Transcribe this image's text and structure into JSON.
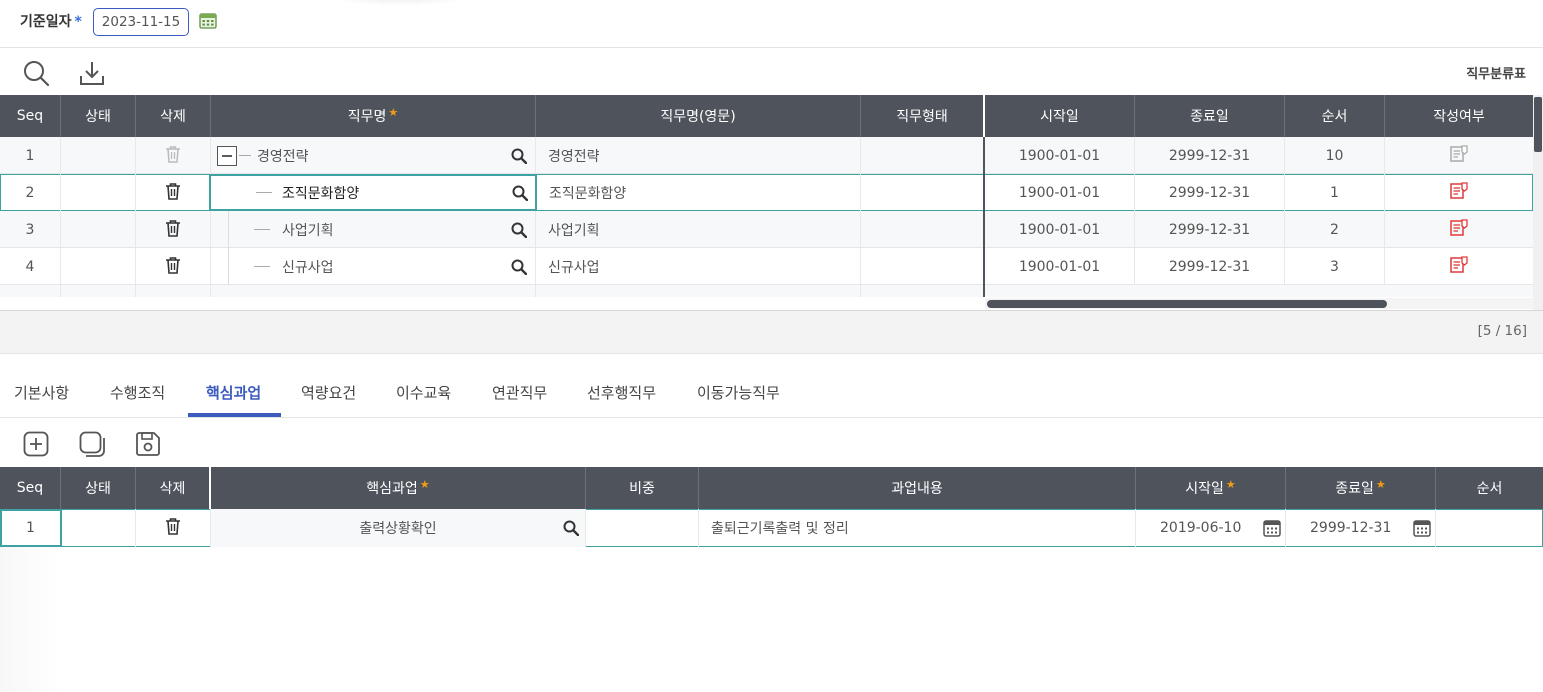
{
  "filter": {
    "label": "기준일자",
    "required_mark": "*",
    "date_value": "2023-11-15",
    "calendar_icon": "calendar-icon"
  },
  "toolbar1": {
    "search_icon": "search-icon",
    "download_icon": "download-icon",
    "right_label": "직무분류표"
  },
  "grid1": {
    "columns": {
      "seq": "Seq",
      "status": "상태",
      "delete": "삭제",
      "job_name": "직무명",
      "job_name_en": "직무명(영문)",
      "job_type": "직무형태",
      "start_date": "시작일",
      "end_date": "종료일",
      "order": "순서",
      "written": "작성여부"
    },
    "required_star": "★",
    "rows": [
      {
        "seq": "1",
        "name": "경영전략",
        "name_en": "경영전략",
        "start": "1900-01-01",
        "end": "2999-12-31",
        "order": "10",
        "written": "not-written",
        "tree": "collapse"
      },
      {
        "seq": "2",
        "name": "조직문화함양",
        "name_en": "조직문화함양",
        "start": "1900-01-01",
        "end": "2999-12-31",
        "order": "1",
        "written": "written",
        "selected": true
      },
      {
        "seq": "3",
        "name": "사업기획",
        "name_en": "사업기획",
        "start": "1900-01-01",
        "end": "2999-12-31",
        "order": "2",
        "written": "written"
      },
      {
        "seq": "4",
        "name": "신규사업",
        "name_en": "신규사업",
        "start": "1900-01-01",
        "end": "2999-12-31",
        "order": "3",
        "written": "written"
      }
    ],
    "page_count": "[5 / 16]"
  },
  "tabs": [
    {
      "label": "기본사항"
    },
    {
      "label": "수행조직"
    },
    {
      "label": "핵심과업",
      "active": true
    },
    {
      "label": "역량요건"
    },
    {
      "label": "이수교육"
    },
    {
      "label": "연관직무"
    },
    {
      "label": "선후행직무"
    },
    {
      "label": "이동가능직무"
    }
  ],
  "toolbar2": {
    "add_icon": "add-icon",
    "copy_icon": "copy-icon",
    "save_icon": "save-icon"
  },
  "grid2": {
    "columns": {
      "seq": "Seq",
      "status": "상태",
      "delete": "삭제",
      "core_task": "핵심과업",
      "weight": "비중",
      "task_content": "과업내용",
      "start_date": "시작일",
      "end_date": "종료일",
      "order": "순서"
    },
    "rows": [
      {
        "seq": "1",
        "status": "",
        "core_task": "출력상황확인",
        "weight": "",
        "task_content": "출퇴근기록출력 및 정리",
        "start": "2019-06-10",
        "end": "2999-12-31",
        "order": ""
      }
    ]
  },
  "colors": {
    "header_bg": "#4e535c",
    "accent": "#3b5bbf",
    "selection": "#3fa2a2",
    "required_star": "#f39c12",
    "written_icon": "#e03a3a"
  }
}
